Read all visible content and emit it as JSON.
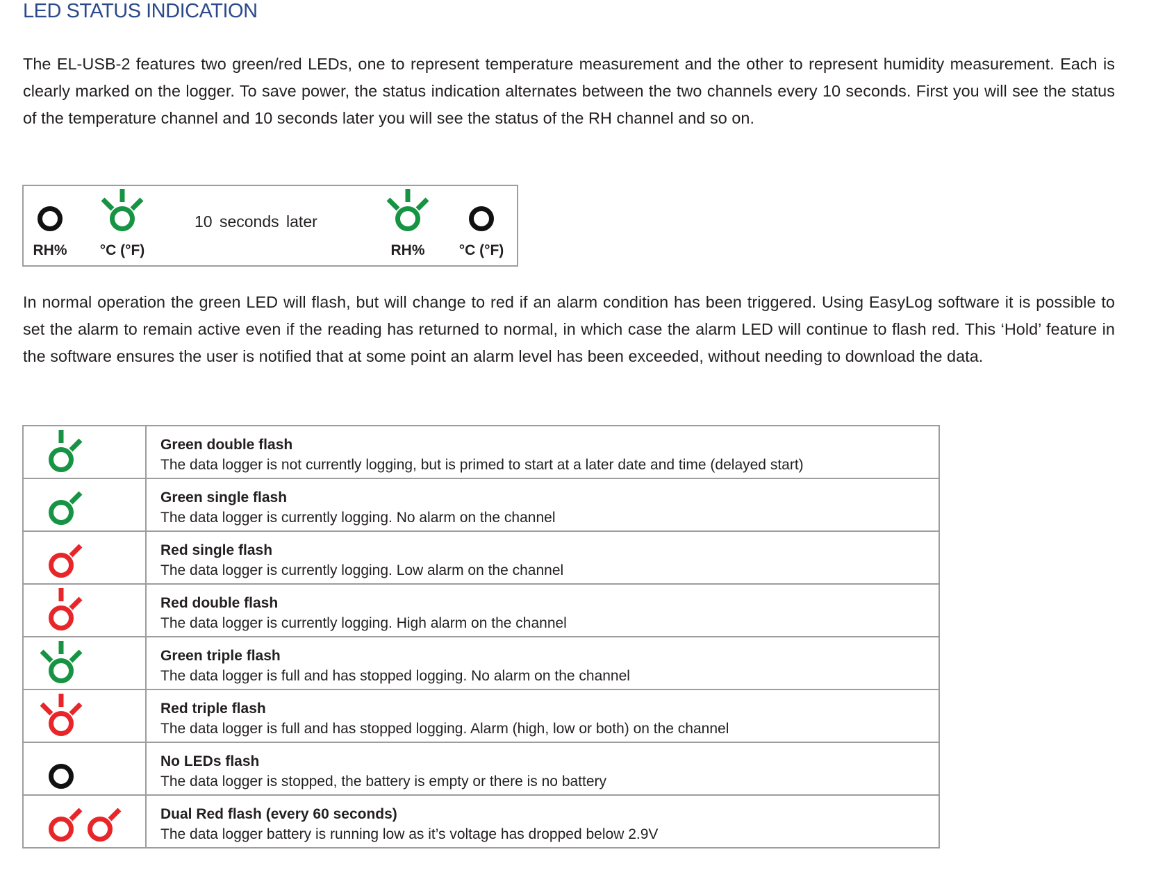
{
  "colors": {
    "green": "#169443",
    "red": "#e8262a",
    "off": "#111111",
    "title": "#2b4a8b"
  },
  "title": "LED STATUS INDICATION",
  "intro": "The EL-USB-2 features two green/red LEDs, one to represent temperature measurement and the other to represent humidity measurement. Each is clearly marked on the logger. To save power, the status indication alternates between the two channels every 10 seconds. First you will see the status of the temperature channel and 10 seconds later you will see the status of the RH channel and so on.",
  "diagram": {
    "middle_text": "10 seconds later",
    "leds": [
      {
        "label": "RH%",
        "color": "off",
        "rays": []
      },
      {
        "label": "°C (°F)",
        "color": "green",
        "rays": [
          "left",
          "up",
          "right"
        ]
      },
      {
        "label": "RH%",
        "color": "green",
        "rays": [
          "left",
          "up",
          "right"
        ]
      },
      {
        "label": "°C (°F)",
        "color": "off",
        "rays": []
      }
    ]
  },
  "operation": "In normal operation the green LED will flash, but will change to red if an alarm condition has been triggered. Using EasyLog software it is possible to set the alarm to remain active even if the reading has returned to normal, in which case the alarm LED will continue to flash red. This ‘Hold’ feature in the software ensures the user is notified that at some point an alarm level has been exceeded, without needing to download the data.",
  "rows": [
    {
      "icon": "green-double-flash-icon",
      "color": "green",
      "rays": [
        "up",
        "right"
      ],
      "count": 1,
      "title": "Green double flash",
      "desc": "The data logger is not currently logging, but is primed to start at a later date and time (delayed start)"
    },
    {
      "icon": "green-single-flash-icon",
      "color": "green",
      "rays": [
        "right"
      ],
      "count": 1,
      "title": "Green single flash",
      "desc": "The data logger is currently logging. No alarm on the channel"
    },
    {
      "icon": "red-single-flash-icon",
      "color": "red",
      "rays": [
        "right"
      ],
      "count": 1,
      "title": "Red single flash",
      "desc": "The data logger is currently logging. Low alarm on the channel"
    },
    {
      "icon": "red-double-flash-icon",
      "color": "red",
      "rays": [
        "up",
        "right"
      ],
      "count": 1,
      "title": "Red double flash",
      "desc": "The data logger is currently logging. High alarm on the channel"
    },
    {
      "icon": "green-triple-flash-icon",
      "color": "green",
      "rays": [
        "left",
        "up",
        "right"
      ],
      "count": 1,
      "title": "Green triple flash",
      "desc": "The data logger is full and has stopped logging. No alarm on the channel"
    },
    {
      "icon": "red-triple-flash-icon",
      "color": "red",
      "rays": [
        "left",
        "up",
        "right"
      ],
      "count": 1,
      "title": "Red triple flash",
      "desc": "The data logger is full and has stopped logging. Alarm (high, low or both) on the channel"
    },
    {
      "icon": "led-off-icon",
      "color": "off",
      "rays": [],
      "count": 1,
      "title": "No LEDs flash",
      "desc": "The data logger is stopped, the battery is empty or there is no battery"
    },
    {
      "icon": "dual-red-flash-icon",
      "color": "red",
      "rays": [
        "right"
      ],
      "count": 2,
      "title": "Dual Red flash (every 60 seconds)",
      "desc": "The data logger battery is running low as it’s voltage has dropped below 2.9V"
    }
  ]
}
